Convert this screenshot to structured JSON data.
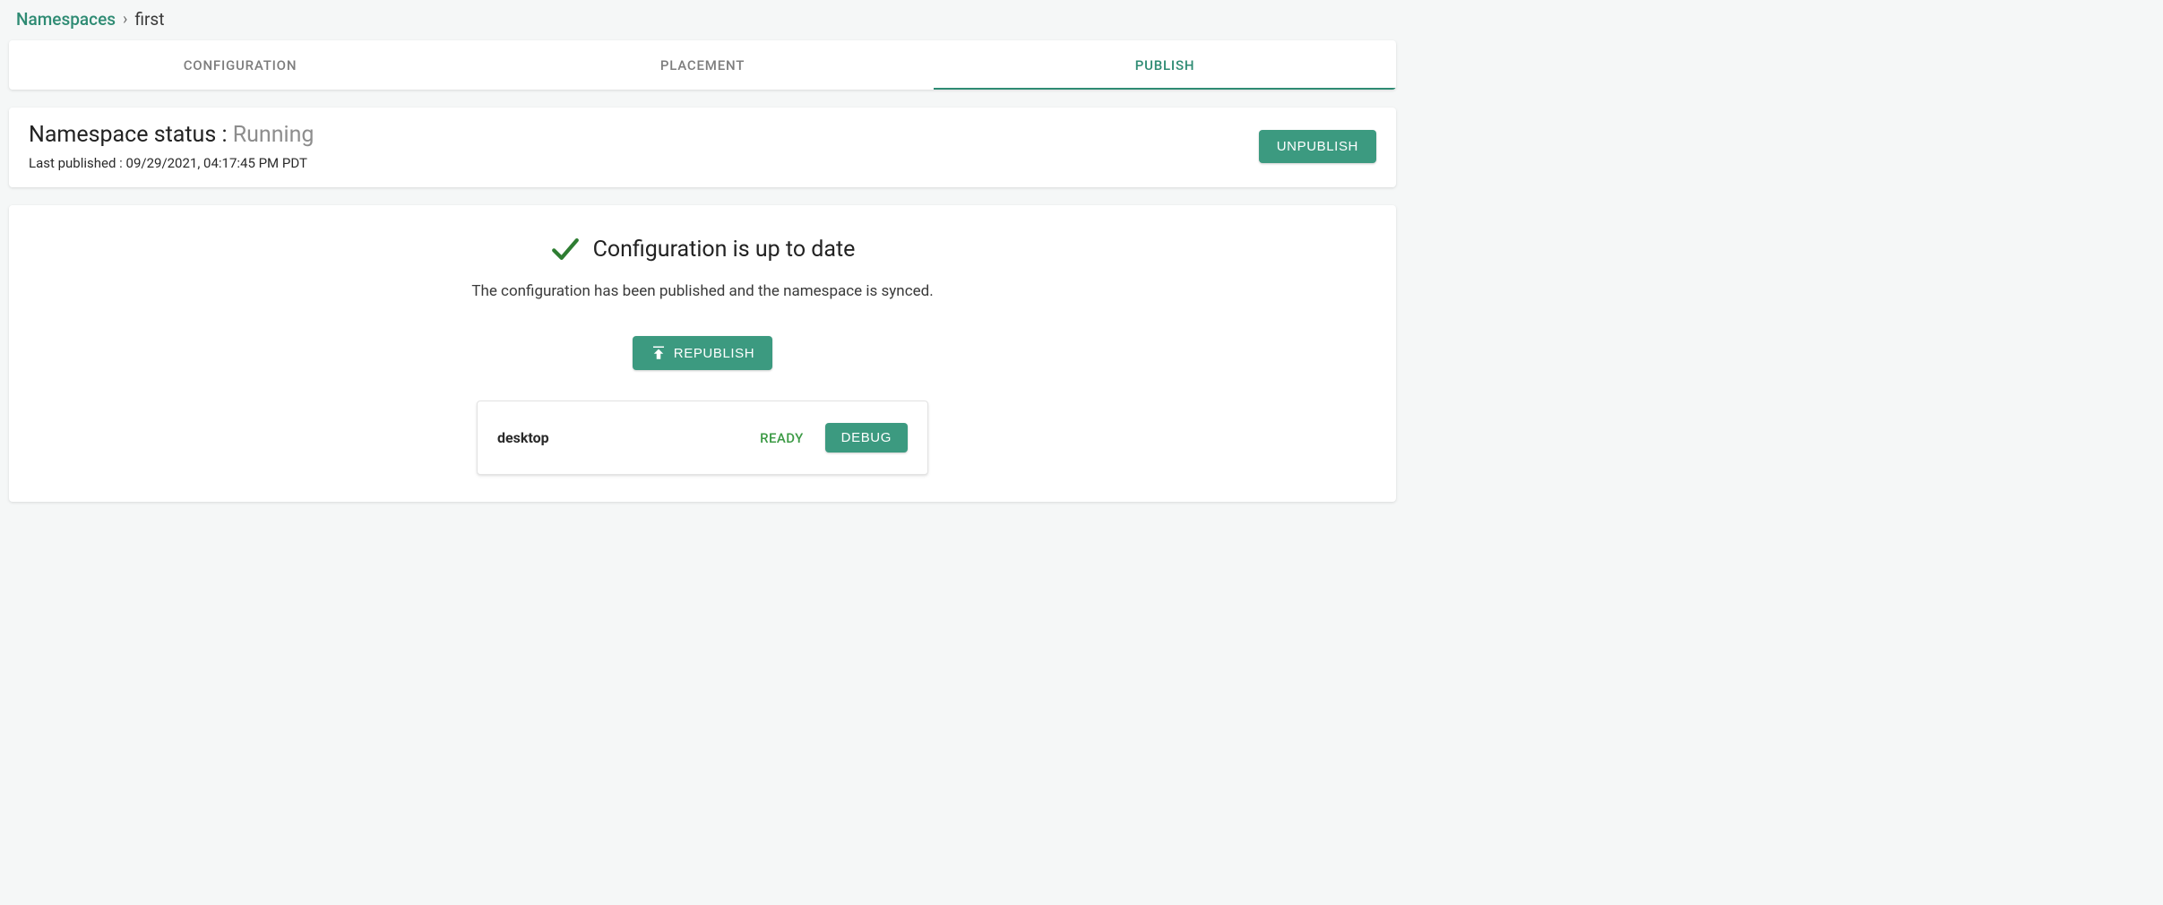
{
  "breadcrumb": {
    "root": "Namespaces",
    "current": "first",
    "separator": "›"
  },
  "tabs": {
    "items": [
      {
        "label": "CONFIGURATION",
        "active": false
      },
      {
        "label": "PLACEMENT",
        "active": false
      },
      {
        "label": "PUBLISH",
        "active": true
      }
    ]
  },
  "status": {
    "title_prefix": "Namespace status :",
    "value": "Running",
    "last_published_label": "Last published :",
    "last_published_value": "09/29/2021, 04:17:45 PM PDT",
    "unpublish_label": "UNPUBLISH"
  },
  "main": {
    "title": "Configuration is up to date",
    "description": "The configuration has been published and the namespace is synced.",
    "republish_label": "REPUBLISH"
  },
  "nodes": [
    {
      "name": "desktop",
      "status": "READY",
      "debug_label": "DEBUG"
    }
  ],
  "colors": {
    "accent": "#3c9a80",
    "muted": "#8d8d8d",
    "ready": "#3c9a45",
    "check": "#2e7d32"
  }
}
